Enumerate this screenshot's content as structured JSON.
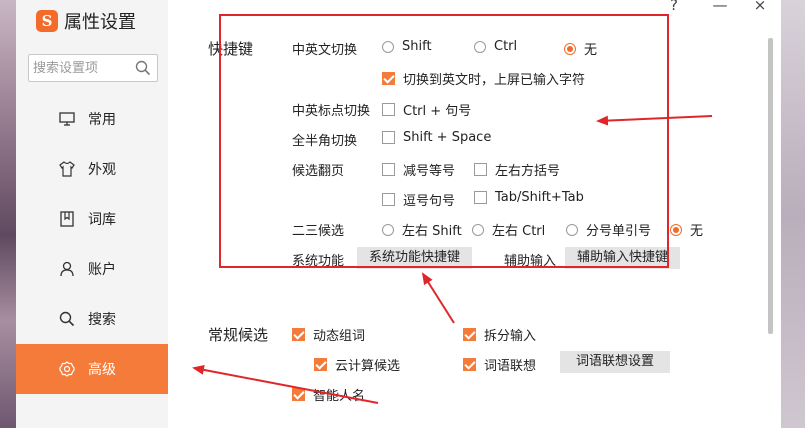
{
  "window": {
    "help": "?",
    "minimize": "—",
    "close": "×"
  },
  "sidebar": {
    "logo_char": "S",
    "title": "属性设置",
    "search_placeholder": "搜索设置项",
    "items": [
      {
        "label": "常用",
        "icon": "monitor-icon"
      },
      {
        "label": "外观",
        "icon": "shirt-icon"
      },
      {
        "label": "词库",
        "icon": "book-icon"
      },
      {
        "label": "账户",
        "icon": "user-icon"
      },
      {
        "label": "搜索",
        "icon": "search-icon"
      },
      {
        "label": "高级",
        "icon": "gear-icon",
        "active": true
      }
    ]
  },
  "shortcuts": {
    "section": "快捷键",
    "cn_en_switch": {
      "label": "中英文切换",
      "options": [
        "Shift",
        "Ctrl",
        "无"
      ],
      "selected": "无",
      "commit_label": "切换到英文时，上屏已输入字符",
      "commit_checked": true
    },
    "punct_switch": {
      "label": "中英标点切换",
      "option": "Ctrl + 句号",
      "checked": false
    },
    "width_switch": {
      "label": "全半角切换",
      "option": "Shift + Space",
      "checked": false
    },
    "paging": {
      "label": "候选翻页",
      "options": [
        {
          "label": "减号等号",
          "checked": false
        },
        {
          "label": "左右方括号",
          "checked": false
        },
        {
          "label": "逗号句号",
          "checked": false
        },
        {
          "label": "Tab/Shift+Tab",
          "checked": false
        }
      ]
    },
    "second_third": {
      "label": "二三候选",
      "options": [
        "左右 Shift",
        "左右 Ctrl",
        "分号单引号",
        "无"
      ],
      "selected": "无"
    },
    "system": {
      "label": "系统功能",
      "button": "系统功能快捷键"
    },
    "aux": {
      "label": "辅助输入",
      "button": "辅助输入快捷键"
    }
  },
  "candidates": {
    "section": "常规候选",
    "items": [
      {
        "label": "动态组词",
        "checked": true
      },
      {
        "label": "拆分输入",
        "checked": true
      },
      {
        "label": "云计算候选",
        "checked": true
      },
      {
        "label": "词语联想",
        "checked": true
      },
      {
        "label": "智能人名",
        "checked": true
      }
    ],
    "assoc_button": "词语联想设置"
  },
  "colors": {
    "accent": "#f47b3a",
    "annotation": "#e1262b"
  }
}
